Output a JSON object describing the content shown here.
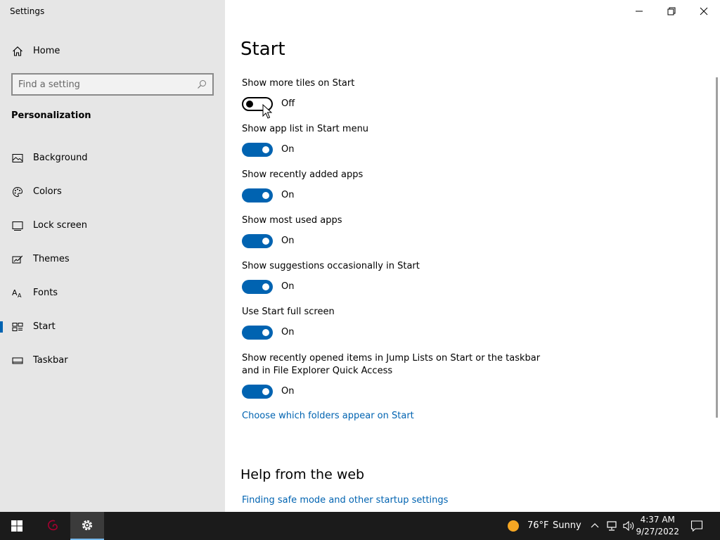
{
  "window": {
    "title": "Settings"
  },
  "sidebar": {
    "home_label": "Home",
    "search_placeholder": "Find a setting",
    "section_title": "Personalization",
    "items": [
      {
        "label": "Background",
        "icon": "picture-icon"
      },
      {
        "label": "Colors",
        "icon": "palette-icon"
      },
      {
        "label": "Lock screen",
        "icon": "lock-screen-icon"
      },
      {
        "label": "Themes",
        "icon": "themes-icon"
      },
      {
        "label": "Fonts",
        "icon": "fonts-icon"
      },
      {
        "label": "Start",
        "icon": "start-icon",
        "selected": true
      },
      {
        "label": "Taskbar",
        "icon": "taskbar-icon"
      }
    ]
  },
  "main": {
    "title": "Start",
    "settings": [
      {
        "label": "Show more tiles on Start",
        "state": "Off"
      },
      {
        "label": "Show app list in Start menu",
        "state": "On"
      },
      {
        "label": "Show recently added apps",
        "state": "On"
      },
      {
        "label": "Show most used apps",
        "state": "On"
      },
      {
        "label": "Show suggestions occasionally in Start",
        "state": "On"
      },
      {
        "label": "Use Start full screen",
        "state": "On"
      },
      {
        "label": "Show recently opened items in Jump Lists on Start or the taskbar and in File Explorer Quick Access",
        "state": "On"
      }
    ],
    "folders_link": "Choose which folders appear on Start",
    "help_title": "Help from the web",
    "help_link": "Finding safe mode and other startup settings"
  },
  "taskbar": {
    "weather_temp": "76°F",
    "weather_condition": "Sunny",
    "time": "4:37 AM",
    "date": "9/27/2022"
  },
  "colors": {
    "accent": "#0063b1",
    "sidebar_bg": "#e6e6e6",
    "taskbar_bg": "#1b1b1b"
  }
}
